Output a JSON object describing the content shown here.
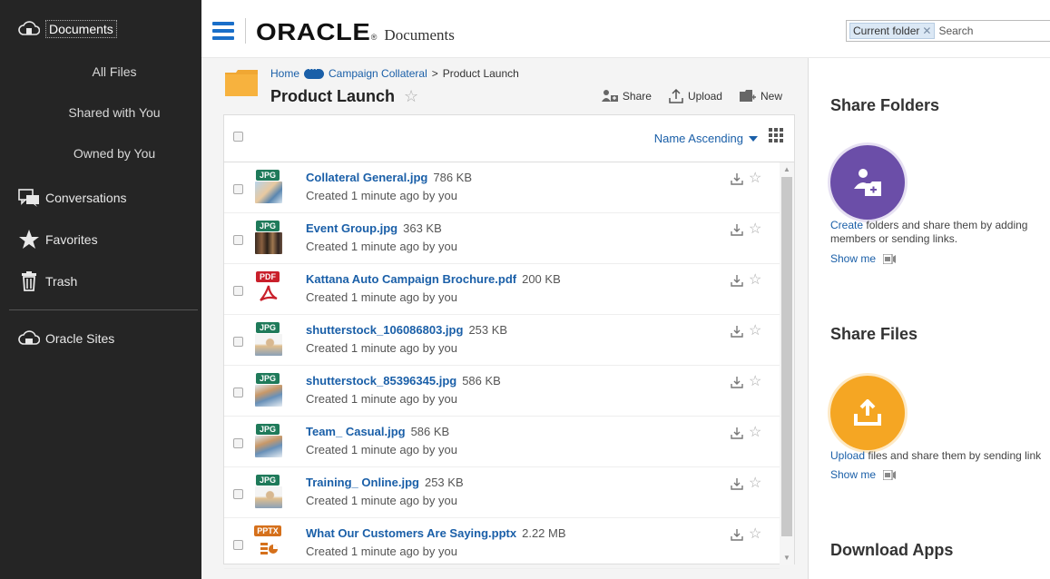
{
  "sidebar": {
    "documents": "Documents",
    "all_files": "All Files",
    "shared_with_you": "Shared with You",
    "owned_by_you": "Owned by You",
    "conversations": "Conversations",
    "favorites": "Favorites",
    "trash": "Trash",
    "oracle_sites": "Oracle Sites"
  },
  "header": {
    "brand": "ORACLE",
    "registered": "®",
    "product": "Documents",
    "search_scope": "Current folder",
    "search_placeholder": "Search"
  },
  "breadcrumb": {
    "home": "Home",
    "collateral": "Campaign Collateral",
    "separator": ">",
    "current": "Product Launch"
  },
  "page": {
    "title": "Product Launch",
    "star": "☆"
  },
  "toolbar": {
    "share": "Share",
    "upload": "Upload",
    "new": "New"
  },
  "list": {
    "sort_label": "Name Ascending",
    "files": [
      {
        "type": "JPG",
        "name": "Collateral General.jpg",
        "size": "786 KB",
        "meta": "Created 1 minute ago by you"
      },
      {
        "type": "JPG",
        "name": "Event Group.jpg",
        "size": "363 KB",
        "meta": "Created 1 minute ago by you"
      },
      {
        "type": "PDF",
        "name": "Kattana Auto Campaign Brochure.pdf",
        "size": "200 KB",
        "meta": "Created 1 minute ago by you"
      },
      {
        "type": "JPG",
        "name": "shutterstock_106086803.jpg",
        "size": "253 KB",
        "meta": "Created 1 minute ago by you"
      },
      {
        "type": "JPG",
        "name": "shutterstock_85396345.jpg",
        "size": "586 KB",
        "meta": "Created 1 minute ago by you"
      },
      {
        "type": "JPG",
        "name": "Team_ Casual.jpg",
        "size": "586 KB",
        "meta": "Created 1 minute ago by you"
      },
      {
        "type": "JPG",
        "name": "Training_ Online.jpg",
        "size": "253 KB",
        "meta": "Created 1 minute ago by you"
      },
      {
        "type": "PPTX",
        "name": "What Our Customers Are Saying.pptx",
        "size": "2.22 MB",
        "meta": "Created 1 minute ago by you"
      }
    ]
  },
  "right_panel": {
    "share_folders_title": "Share Folders",
    "share_folders_link": "Create",
    "share_folders_text": " folders and share them by adding members or sending links.",
    "show_me_1": "Show me",
    "share_files_title": "Share Files",
    "share_files_link": "Upload",
    "share_files_text": " files and share them by sending link",
    "show_me_2": "Show me",
    "download_apps_title": "Download Apps"
  },
  "colors": {
    "sidebar_bg": "#252525",
    "link_blue": "#1a5fa8",
    "hamburger_blue": "#1a6fc9",
    "folder_orange": "#f5a623",
    "share_purple": "#6b4ea8",
    "jpg_badge": "#1f7a5a",
    "pdf_badge": "#c9202b",
    "pptx_badge": "#d5701b"
  }
}
